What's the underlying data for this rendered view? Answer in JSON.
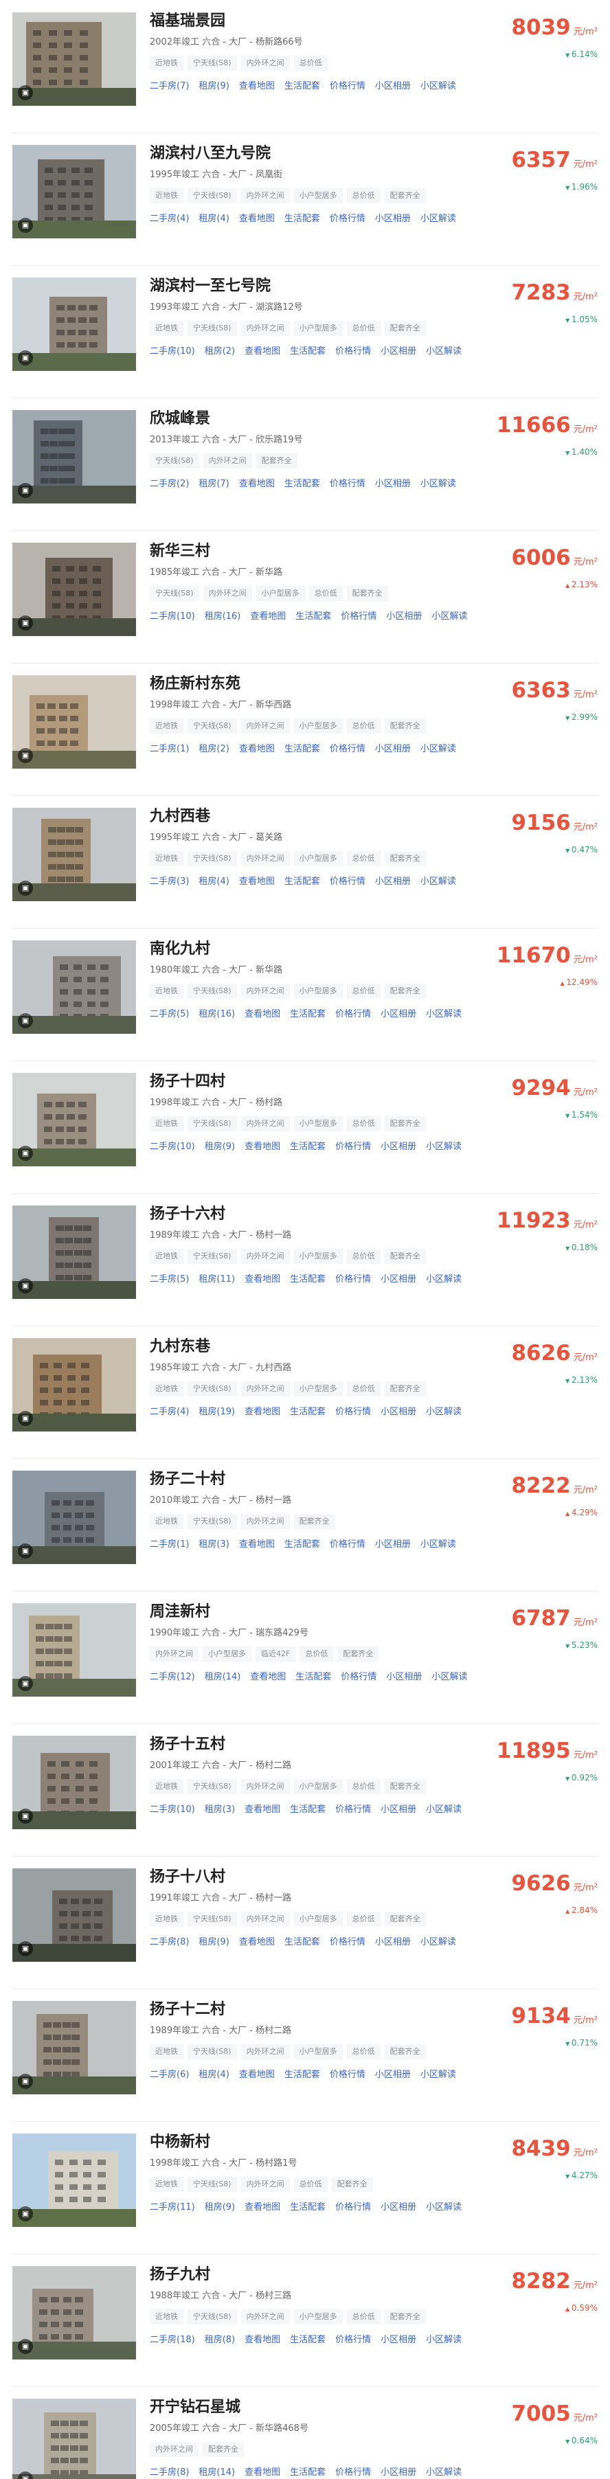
{
  "unit_label": "元/m²",
  "listings": [
    {
      "name": "福基瑞景园",
      "meta": "2002年竣工 六合 - 大厂 - 杨新路66号",
      "tags": [
        "近地铁",
        "宁天线(S8)",
        "内外环之间",
        "总价低"
      ],
      "price": "8039",
      "change": "6.14%",
      "dir": "down",
      "links": [
        "二手房(7)",
        "租房(9)",
        "查看地图",
        "生活配套",
        "价格行情",
        "小区相册",
        "小区解读"
      ],
      "photo": "p1"
    },
    {
      "name": "湖滨村八至九号院",
      "meta": "1995年竣工 六合 - 大厂 - 凤凰街",
      "tags": [
        "近地铁",
        "宁天线(S8)",
        "内外环之间",
        "小户型居多",
        "总价低",
        "配套齐全"
      ],
      "price": "6357",
      "change": "1.96%",
      "dir": "down",
      "links": [
        "二手房(4)",
        "租房(4)",
        "查看地图",
        "生活配套",
        "价格行情",
        "小区相册",
        "小区解读"
      ],
      "photo": "p2"
    },
    {
      "name": "湖滨村一至七号院",
      "meta": "1993年竣工 六合 - 大厂 - 湖滨路12号",
      "tags": [
        "近地铁",
        "宁天线(S8)",
        "内外环之间",
        "小户型居多",
        "总价低",
        "配套齐全"
      ],
      "price": "7283",
      "change": "1.05%",
      "dir": "down",
      "links": [
        "二手房(10)",
        "租房(2)",
        "查看地图",
        "生活配套",
        "价格行情",
        "小区相册",
        "小区解读"
      ],
      "photo": "p3"
    },
    {
      "name": "欣城峰景",
      "meta": "2013年竣工 六合 - 大厂 - 欣乐路19号",
      "tags": [
        "宁天线(S8)",
        "内外环之间",
        "配套齐全"
      ],
      "price": "11666",
      "change": "1.40%",
      "dir": "down",
      "links": [
        "二手房(2)",
        "租房(7)",
        "查看地图",
        "生活配套",
        "价格行情",
        "小区相册",
        "小区解读"
      ],
      "photo": "p4"
    },
    {
      "name": "新华三村",
      "meta": "1985年竣工 六合 - 大厂 - 新华路",
      "tags": [
        "宁天线(S8)",
        "内外环之间",
        "小户型居多",
        "总价低",
        "配套齐全"
      ],
      "price": "6006",
      "change": "2.13%",
      "dir": "up",
      "links": [
        "二手房(10)",
        "租房(16)",
        "查看地图",
        "生活配套",
        "价格行情",
        "小区相册",
        "小区解读"
      ],
      "photo": "p5"
    },
    {
      "name": "杨庄新村东苑",
      "meta": "1998年竣工 六合 - 大厂 - 新华西路",
      "tags": [
        "近地铁",
        "宁天线(S8)",
        "内外环之间",
        "小户型居多",
        "总价低",
        "配套齐全"
      ],
      "price": "6363",
      "change": "2.99%",
      "dir": "down",
      "links": [
        "二手房(1)",
        "租房(2)",
        "查看地图",
        "生活配套",
        "价格行情",
        "小区相册",
        "小区解读"
      ],
      "photo": "p6"
    },
    {
      "name": "九村西巷",
      "meta": "1995年竣工 六合 - 大厂 - 葛关路",
      "tags": [
        "近地铁",
        "宁天线(S8)",
        "内外环之间",
        "小户型居多",
        "总价低",
        "配套齐全"
      ],
      "price": "9156",
      "change": "0.47%",
      "dir": "down",
      "links": [
        "二手房(3)",
        "租房(4)",
        "查看地图",
        "生活配套",
        "价格行情",
        "小区相册",
        "小区解读"
      ],
      "photo": "p7"
    },
    {
      "name": "南化九村",
      "meta": "1980年竣工 六合 - 大厂 - 新华路",
      "tags": [
        "近地铁",
        "宁天线(S8)",
        "内外环之间",
        "小户型居多",
        "总价低",
        "配套齐全"
      ],
      "price": "11670",
      "change": "12.49%",
      "dir": "up",
      "links": [
        "二手房(5)",
        "租房(16)",
        "查看地图",
        "生活配套",
        "价格行情",
        "小区相册",
        "小区解读"
      ],
      "photo": "p8"
    },
    {
      "name": "扬子十四村",
      "meta": "1998年竣工 六合 - 大厂 - 杨村路",
      "tags": [
        "近地铁",
        "宁天线(S8)",
        "内外环之间",
        "小户型居多",
        "总价低",
        "配套齐全"
      ],
      "price": "9294",
      "change": "1.54%",
      "dir": "down",
      "links": [
        "二手房(10)",
        "租房(9)",
        "查看地图",
        "生活配套",
        "价格行情",
        "小区相册",
        "小区解读"
      ],
      "photo": "p9"
    },
    {
      "name": "扬子十六村",
      "meta": "1989年竣工 六合 - 大厂 - 杨村一路",
      "tags": [
        "近地铁",
        "宁天线(S8)",
        "内外环之间",
        "小户型居多",
        "总价低",
        "配套齐全"
      ],
      "price": "11923",
      "change": "0.18%",
      "dir": "down",
      "links": [
        "二手房(5)",
        "租房(11)",
        "查看地图",
        "生活配套",
        "价格行情",
        "小区相册",
        "小区解读"
      ],
      "photo": "p10"
    },
    {
      "name": "九村东巷",
      "meta": "1985年竣工 六合 - 大厂 - 九村西路",
      "tags": [
        "近地铁",
        "宁天线(S8)",
        "内外环之间",
        "小户型居多",
        "总价低",
        "配套齐全"
      ],
      "price": "8626",
      "change": "2.13%",
      "dir": "down",
      "links": [
        "二手房(4)",
        "租房(19)",
        "查看地图",
        "生活配套",
        "价格行情",
        "小区相册",
        "小区解读"
      ],
      "photo": "p11"
    },
    {
      "name": "扬子二十村",
      "meta": "2010年竣工 六合 - 大厂 - 杨村一路",
      "tags": [
        "近地铁",
        "宁天线(S8)",
        "内外环之间",
        "配套齐全"
      ],
      "price": "8222",
      "change": "4.29%",
      "dir": "up",
      "links": [
        "二手房(1)",
        "租房(3)",
        "查看地图",
        "生活配套",
        "价格行情",
        "小区相册",
        "小区解读"
      ],
      "photo": "p12"
    },
    {
      "name": "周洼新村",
      "meta": "1990年竣工 六合 - 大厂 - 瑞东路429号",
      "tags": [
        "内外环之间",
        "小户型居多",
        "临近42F",
        "总价低",
        "配套齐全"
      ],
      "price": "6787",
      "change": "5.23%",
      "dir": "down",
      "links": [
        "二手房(12)",
        "租房(14)",
        "查看地图",
        "生活配套",
        "价格行情",
        "小区相册",
        "小区解读"
      ],
      "photo": "p13"
    },
    {
      "name": "扬子十五村",
      "meta": "2001年竣工 六合 - 大厂 - 杨村二路",
      "tags": [
        "近地铁",
        "宁天线(S8)",
        "内外环之间",
        "小户型居多",
        "总价低",
        "配套齐全"
      ],
      "price": "11895",
      "change": "0.92%",
      "dir": "down",
      "links": [
        "二手房(10)",
        "租房(3)",
        "查看地图",
        "生活配套",
        "价格行情",
        "小区相册",
        "小区解读"
      ],
      "photo": "p14"
    },
    {
      "name": "扬子十八村",
      "meta": "1991年竣工 六合 - 大厂 - 杨村一路",
      "tags": [
        "近地铁",
        "宁天线(S8)",
        "内外环之间",
        "小户型居多",
        "总价低",
        "配套齐全"
      ],
      "price": "9626",
      "change": "2.84%",
      "dir": "up",
      "links": [
        "二手房(8)",
        "租房(9)",
        "查看地图",
        "生活配套",
        "价格行情",
        "小区相册",
        "小区解读"
      ],
      "photo": "p15"
    },
    {
      "name": "扬子十二村",
      "meta": "1989年竣工 六合 - 大厂 - 杨村二路",
      "tags": [
        "近地铁",
        "宁天线(S8)",
        "内外环之间",
        "小户型居多",
        "总价低",
        "配套齐全"
      ],
      "price": "9134",
      "change": "0.71%",
      "dir": "down",
      "links": [
        "二手房(6)",
        "租房(4)",
        "查看地图",
        "生活配套",
        "价格行情",
        "小区相册",
        "小区解读"
      ],
      "photo": "p16"
    },
    {
      "name": "中杨新村",
      "meta": "1998年竣工 六合 - 大厂 - 杨村路1号",
      "tags": [
        "近地铁",
        "宁天线(S8)",
        "内外环之间",
        "总价低",
        "配套齐全"
      ],
      "price": "8439",
      "change": "4.27%",
      "dir": "down",
      "links": [
        "二手房(11)",
        "租房(9)",
        "查看地图",
        "生活配套",
        "价格行情",
        "小区相册",
        "小区解读"
      ],
      "photo": "p17"
    },
    {
      "name": "扬子九村",
      "meta": "1988年竣工 六合 - 大厂 - 杨村三路",
      "tags": [
        "近地铁",
        "宁天线(S8)",
        "内外环之间",
        "小户型居多",
        "总价低",
        "配套齐全"
      ],
      "price": "8282",
      "change": "0.59%",
      "dir": "up",
      "links": [
        "二手房(18)",
        "租房(8)",
        "查看地图",
        "生活配套",
        "价格行情",
        "小区相册",
        "小区解读"
      ],
      "photo": "p18"
    },
    {
      "name": "开宁钻石星城",
      "meta": "2005年竣工 六合 - 大厂 - 新华路468号",
      "tags": [
        "内外环之间",
        "配套齐全"
      ],
      "price": "7005",
      "change": "0.64%",
      "dir": "down",
      "links": [
        "二手房(8)",
        "租房(14)",
        "查看地图",
        "生活配套",
        "价格行情",
        "小区相册",
        "小区解读"
      ],
      "photo": "p19"
    }
  ]
}
